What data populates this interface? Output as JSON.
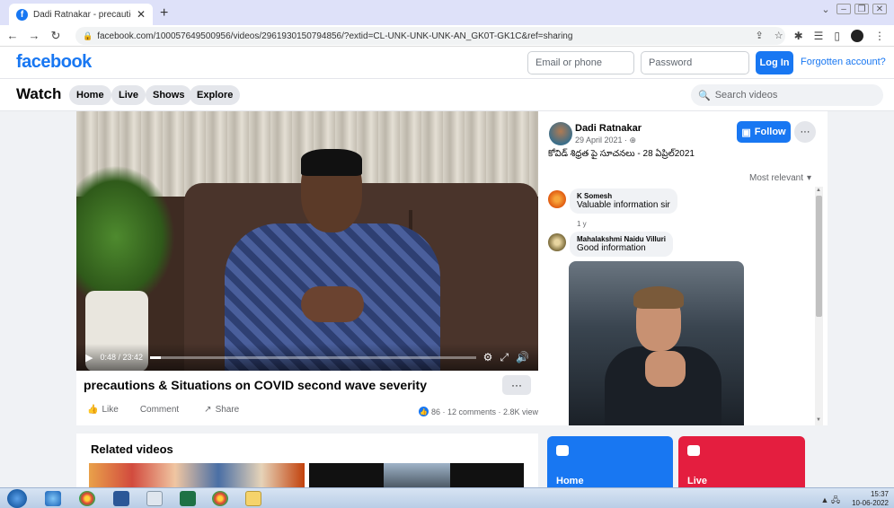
{
  "browser": {
    "tab_title": "Dadi Ratnakar - precautions & Si",
    "url": "facebook.com/100057649500956/videos/2961930150794856/?extid=CL-UNK-UNK-UNK-AN_GK0T-GK1C&ref=sharing"
  },
  "header": {
    "logo": "facebook",
    "email_placeholder": "Email or phone",
    "password_placeholder": "Password",
    "login_label": "Log In",
    "forgot_label": "Forgotten account?"
  },
  "watch": {
    "title": "Watch",
    "nav": [
      "Home",
      "Live",
      "Shows",
      "Explore"
    ],
    "search_placeholder": "Search videos"
  },
  "video": {
    "time": "0:48 / 23:42",
    "progress": 0.034,
    "title": "precautions & Situations on COVID second wave severity",
    "more_label": "···",
    "actions": {
      "like": "Like",
      "comment": "Comment",
      "share": "Share"
    },
    "stats": "86 · 12 comments · 2.8K views"
  },
  "post": {
    "author": "Dadi Ratnakar",
    "date": "29 April 2021 · ",
    "caption": "కోవిడ్ శిధ్రత పై సూచనలు - 28 ఏప్రిల్2021",
    "follow_label": "Follow",
    "more_label": "···",
    "sort_label": "Most relevant"
  },
  "comments": [
    {
      "name": "K Somesh",
      "text": "Valuable information sir",
      "meta": "1 y"
    },
    {
      "name": "Mahalakshmi Naidu Villuri",
      "text": "Good information",
      "meta": ""
    }
  ],
  "related": {
    "title": "Related videos"
  },
  "cards": {
    "home": "Home",
    "live": "Live"
  },
  "taskbar": {
    "time": "15:37",
    "date": "10-06-2022"
  }
}
